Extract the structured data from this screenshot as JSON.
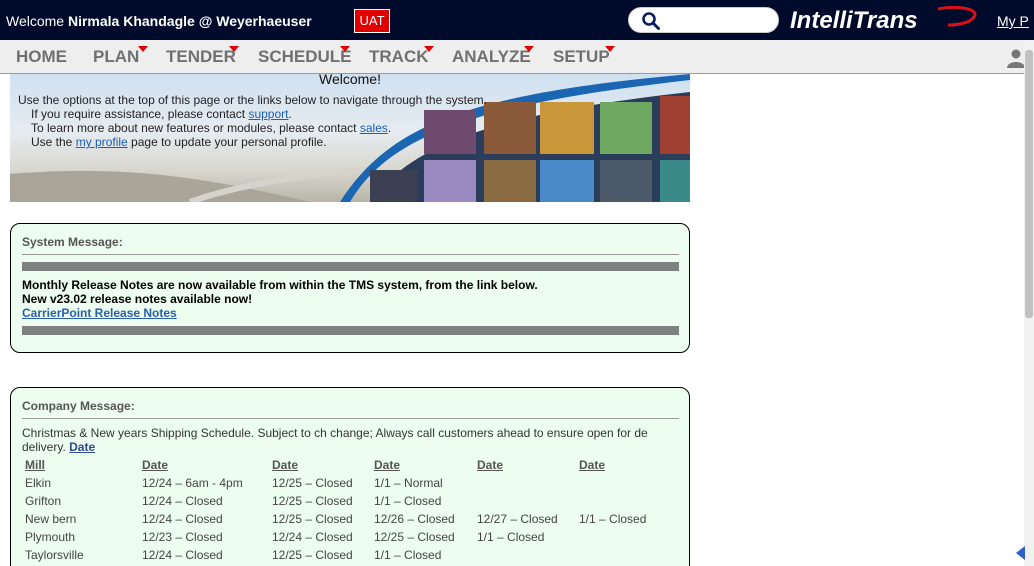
{
  "header": {
    "welcome_prefix": "Welcome",
    "user": "Nirmala Khandagle @ Weyerhaeuser",
    "env_badge": "UAT",
    "search_icon": "search-icon",
    "logo_text": "IntelliTrans",
    "my_link": "My P",
    "bg_color": "#000a2a",
    "badge_color": "#e00000"
  },
  "nav": {
    "items": [
      {
        "label": "HOME",
        "has_menu": false
      },
      {
        "label": "PLAN",
        "has_menu": true
      },
      {
        "label": "TENDER",
        "has_menu": true
      },
      {
        "label": "SCHEDULE",
        "has_menu": true
      },
      {
        "label": "TRACK",
        "has_menu": true
      },
      {
        "label": "ANALYZE",
        "has_menu": true
      },
      {
        "label": "SETUP",
        "has_menu": true
      }
    ],
    "user_icon": "user-icon"
  },
  "banner": {
    "title": "Welcome!",
    "line1": "Use the options at the top of this page or the links below to navigate through the system.",
    "line2_pre": "If you require assistance, please contact ",
    "line2_link": "support",
    "line2_post": ".",
    "line3_pre": "To learn more about new features or modules, please contact ",
    "line3_link": "sales",
    "line3_post": ".",
    "line4_pre": "Use the ",
    "line4_link": "my profile",
    "line4_post": " page to update your personal profile."
  },
  "system_message": {
    "header": "System Message:",
    "line1": "Monthly Release Notes are now available from within the TMS system, from the link below.",
    "line2": "New v23.02 release notes available now!",
    "link": "CarrierPoint Release Notes"
  },
  "company_message": {
    "header": "Company Message:",
    "intro": "Christmas & New years Shipping Schedule. Subject to ch change; Always call customers ahead to ensure open for de delivery.",
    "intro_link": "Date",
    "columns": [
      "Mill",
      "Date",
      "Date",
      "Date",
      "Date",
      "Date"
    ],
    "rows": [
      [
        "Elkin",
        "12/24 – 6am - 4pm",
        "12/25 – Closed",
        "1/1 – Normal",
        "",
        ""
      ],
      [
        "Grifton",
        "12/24 – Closed",
        "12/25 – Closed",
        "1/1 – Closed",
        "",
        ""
      ],
      [
        "New bern",
        "12/24 – Closed",
        "12/25 – Closed",
        "12/26 – Closed",
        "12/27 – Closed",
        "1/1 – Closed"
      ],
      [
        "Plymouth",
        "12/23 – Closed",
        "12/24 – Closed",
        "12/25 – Closed",
        "1/1 – Closed",
        ""
      ],
      [
        "Taylorsville",
        "12/24 – Closed",
        "12/25 – Closed",
        "1/1 – Closed",
        "",
        ""
      ]
    ]
  }
}
